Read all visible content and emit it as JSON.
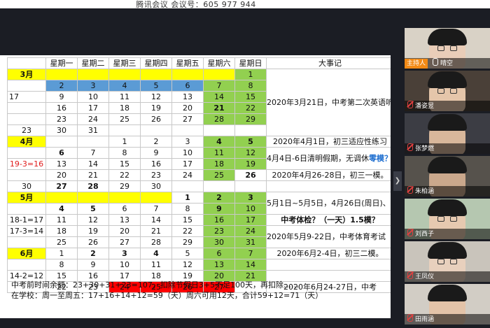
{
  "meeting": {
    "title": "腾讯会议 会议号：605 977 944"
  },
  "calendar": {
    "weekdays": [
      "星期一",
      "星期二",
      "星期三",
      "星期四",
      "星期五",
      "星期六",
      "星期日"
    ],
    "events_header": "大事记",
    "month3": {
      "label": "3月",
      "r1": [
        "",
        "",
        "",
        "",
        "",
        "",
        "1"
      ],
      "r2": [
        "2",
        "3",
        "4",
        "5",
        "6",
        "7",
        "8"
      ],
      "r3_left": "17",
      "r3": [
        "9",
        "10",
        "11",
        "12",
        "13",
        "14",
        "15"
      ],
      "r4": [
        "16",
        "17",
        "18",
        "19",
        "20",
        "21",
        "22"
      ],
      "r5": [
        "23",
        "24",
        "25",
        "26",
        "27",
        "28",
        "29"
      ],
      "r6_left": "23",
      "r6": [
        "30",
        "31",
        "",
        "",
        "",
        "",
        ""
      ],
      "note": "2020年3月21日，中考第二次英语听说机考考试。"
    },
    "month4": {
      "label": "4月",
      "r1": [
        "",
        "",
        "1",
        "2",
        "3",
        "4",
        "5"
      ],
      "r2": [
        "6",
        "7",
        "8",
        "9",
        "10",
        "11",
        "12"
      ],
      "r3_left": "19-3=16",
      "r3": [
        "13",
        "14",
        "15",
        "16",
        "17",
        "18",
        "19"
      ],
      "r4": [
        "20",
        "21",
        "22",
        "23",
        "24",
        "25",
        "26"
      ],
      "r5_left": "30",
      "r5": [
        "27",
        "28",
        "29",
        "30",
        "",
        "",
        ""
      ],
      "note1": "2020年4月1日，初三适应性练习",
      "note2_black": "4月4日-6日清明假期，无调休",
      "note2_blue": "零模？",
      "note3": "2020年4月26-28日，初三一模。"
    },
    "month5": {
      "label": "5月",
      "r1": [
        "",
        "",
        "",
        "",
        "1",
        "2",
        "3"
      ],
      "r2": [
        "4",
        "5",
        "6",
        "7",
        "8",
        "9",
        "10"
      ],
      "r3_left": "18-1=17",
      "r3": [
        "11",
        "12",
        "13",
        "14",
        "15",
        "16",
        "17"
      ],
      "r4_left": "17-3=14",
      "r4": [
        "18",
        "19",
        "20",
        "21",
        "22",
        "23",
        "24"
      ],
      "r5": [
        "25",
        "26",
        "27",
        "28",
        "29",
        "30",
        "31"
      ],
      "note1": "5月1日~5月5日，4月26日(周日)、5月9日(周六)上班",
      "note2_blue": "中考体检？（一天）1.5模？",
      "note3": "2020年5月9-22日，中考体育考试（5月30日补考）。"
    },
    "month6": {
      "label": "6月",
      "r1": [
        "1",
        "2",
        "3",
        "4",
        "5",
        "6",
        "7"
      ],
      "r2": [
        "8",
        "9",
        "10",
        "11",
        "12",
        "13",
        "14"
      ],
      "r3_left": "14-2=12",
      "r3": [
        "15",
        "16",
        "17",
        "18",
        "19",
        "20",
        "21"
      ],
      "r4": [
        "22",
        "23",
        "24",
        "25",
        "26",
        "27",
        ""
      ],
      "note1": "2020年6月2-4日，初三二模。",
      "note2": "2020年6月24-27日，中考"
    }
  },
  "footer": {
    "line1": "中考前时间余额：23+30+31+23=107，扣除节假日3+5不足100天，再扣除……",
    "line2": "在学校：周一至周五：17+16+14+12=59（天）周六可用12天，合计59+12=71（天）"
  },
  "participants": [
    {
      "name": "晴空",
      "host_label": "主持人",
      "skin": "#e9cdb8",
      "bg": "#d9d2c6"
    },
    {
      "name": "潘姿昱",
      "skin": "#e5c6aa",
      "bg": "#4a4038"
    },
    {
      "name": "张梦燃",
      "skin": "#d8b79b",
      "bg": "#3c3d44"
    },
    {
      "name": "朱柏涵",
      "skin": "#caa88c",
      "bg": "#56524c"
    },
    {
      "name": "刘西子",
      "skin": "#e6c9b0",
      "bg": "#b5c7b0"
    },
    {
      "name": "王凤仪",
      "skin": "#e8d0bd",
      "bg": "#c9c4bb"
    },
    {
      "name": "田雨涵",
      "skin": "#e3c3a8",
      "bg": "#d2cdc5"
    }
  ],
  "colors": {
    "highlight_yellow": "#ffff00",
    "weekend_green": "#92d050",
    "week_blue": "#5b9bd5",
    "exam_red": "#ff0000",
    "note_red": "#e02020",
    "note_blue": "#1f6fd0"
  }
}
